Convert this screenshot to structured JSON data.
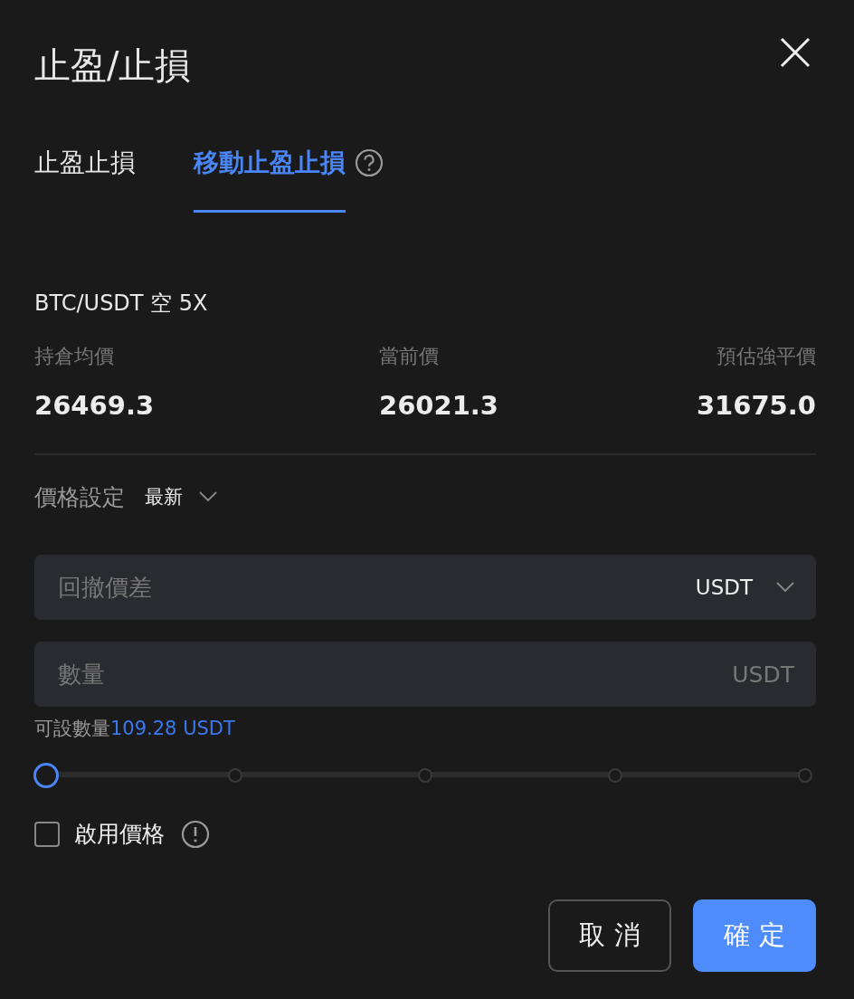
{
  "dialog": {
    "title": "止盈/止損"
  },
  "tabs": [
    {
      "label": "止盈止損",
      "selected": false,
      "help": false
    },
    {
      "label": "移動止盈止損",
      "selected": true,
      "help": true
    }
  ],
  "position": {
    "pair": "BTC/USDT 空 5X",
    "stats": [
      {
        "label": "持倉均價",
        "value": "26469.3"
      },
      {
        "label": "當前價",
        "value": "26021.3"
      },
      {
        "label": "預估強平價",
        "value": "31675.0"
      }
    ]
  },
  "price_setting": {
    "label": "價格設定",
    "value": "最新"
  },
  "fields": [
    {
      "placeholder": "回撤價差",
      "unit": "USDT",
      "dropdown": true
    },
    {
      "placeholder": "數量",
      "unit": "USDT",
      "dropdown": false
    }
  ],
  "available": {
    "label": "可設數量",
    "value": "109.28 USDT"
  },
  "slider": {
    "level": 0
  },
  "enable_price": {
    "label": "啟用價格",
    "checked": false
  },
  "buttons": [
    {
      "label": "取 消",
      "kind": "secondary"
    },
    {
      "label": "確 定",
      "kind": "primary"
    }
  ]
}
